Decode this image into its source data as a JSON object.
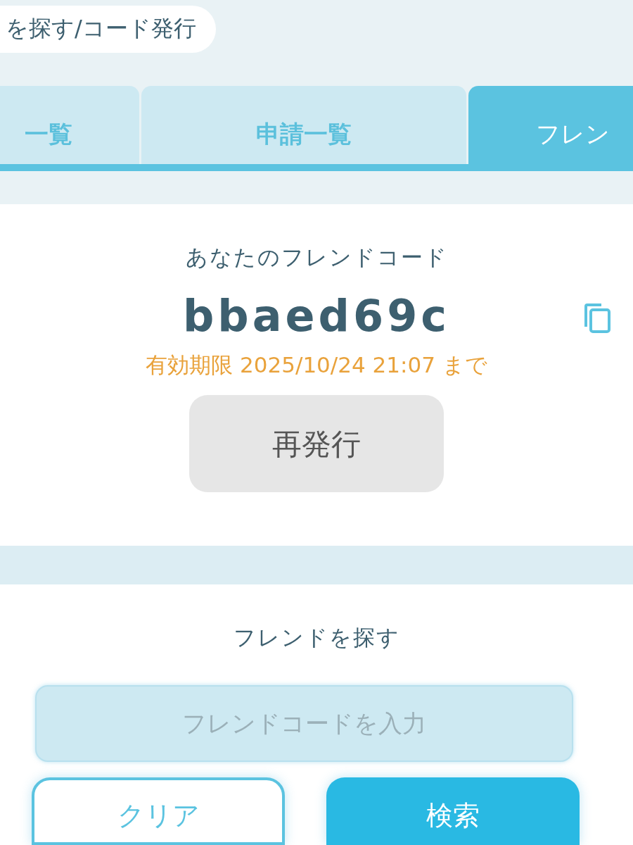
{
  "header": {
    "title": "を探す/コード発行"
  },
  "tabs": [
    {
      "label": "一覧",
      "selected": false
    },
    {
      "label": "申請一覧",
      "selected": false
    },
    {
      "label": "フレン",
      "selected": true
    }
  ],
  "code_card": {
    "title": "あなたのフレンドコード",
    "code": "bbaed69c",
    "expiry": "有効期限 2025/10/24 21:07 まで",
    "reissue_button": "再発行"
  },
  "search_card": {
    "title": "フレンドを探す",
    "input": {
      "placeholder": "フレンドコードを入力"
    },
    "buttons": [
      {
        "kind": "outline",
        "label": "クリア"
      },
      {
        "kind": "primary",
        "label": "検索"
      }
    ]
  }
}
